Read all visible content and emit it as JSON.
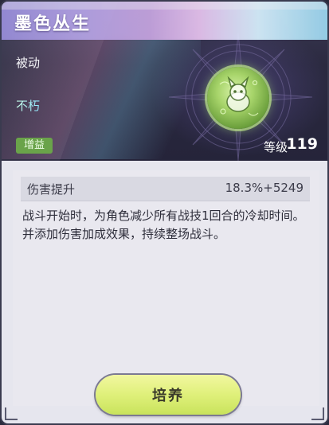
{
  "skill": {
    "name": "墨色丛生",
    "type": "被动",
    "trait": "不朽",
    "tag": "增益",
    "level_label": "等级",
    "level_value": "119",
    "icon": "green-creature-emblem-icon"
  },
  "stat": {
    "name": "伤害提升",
    "value": "18.3%+5249"
  },
  "description": "战斗开始时，为角色减少所有战技1回合的冷却时间。并添加伤害加成效果，持续整场战斗。",
  "actions": {
    "cultivate_label": "培养"
  },
  "colors": {
    "accent_green": "#c9e35c",
    "buff_badge": "#6aa34a",
    "title_gradient_start": "#9a8fdc",
    "title_gradient_end": "#9ad7f0"
  }
}
